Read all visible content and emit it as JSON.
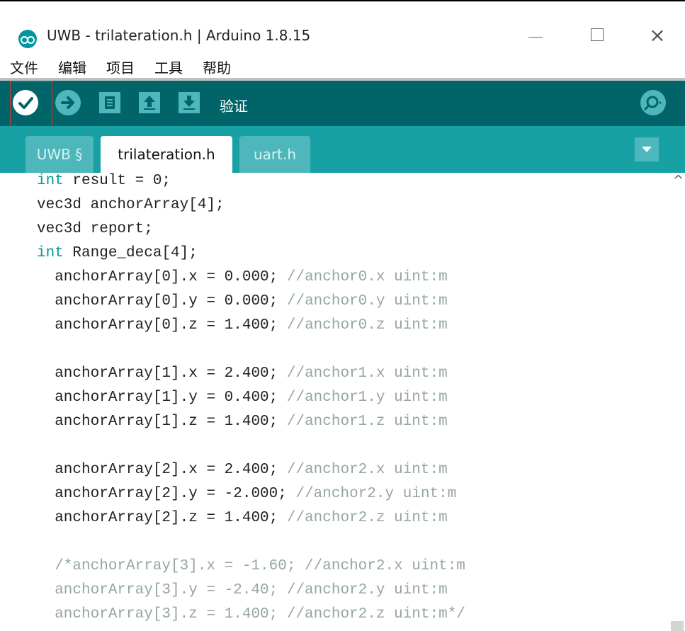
{
  "window": {
    "title": "UWB - trilateration.h | Arduino 1.8.15",
    "minimize_label": "—",
    "maximize_label": "☐",
    "close_label": "×"
  },
  "menubar": {
    "items": [
      "文件",
      "编辑",
      "项目",
      "工具",
      "帮助"
    ]
  },
  "toolbar": {
    "tooltip": "验证"
  },
  "tabs": [
    "UWB §",
    "trilateration.h",
    "uart.h"
  ],
  "editor": {
    "lines": [
      "int result = 0;",
      "vec3d anchorArray[4];",
      "vec3d report;",
      "int Range_deca[4];",
      "  anchorArray[0].x = 0.000; //anchor0.x uint:m",
      "  anchorArray[0].y = 0.000; //anchor0.y uint:m",
      "  anchorArray[0].z = 1.400; //anchor0.z uint:m",
      "",
      "  anchorArray[1].x = 2.400; //anchor1.x uint:m",
      "  anchorArray[1].y = 0.400; //anchor1.y uint:m",
      "  anchorArray[1].z = 1.400; //anchor1.z uint:m",
      "",
      "  anchorArray[2].x = 2.400; //anchor2.x uint:m",
      "  anchorArray[2].y = -2.000; //anchor2.y uint:m",
      "  anchorArray[2].z = 1.400; //anchor2.z uint:m",
      "",
      "  /*anchorArray[3].x = -1.60; //anchor2.x uint:m",
      "  anchorArray[3].y = -2.40; //anchor2.y uint:m",
      "  anchorArray[3].z = 1.400; //anchor2.z uint:m*/"
    ]
  },
  "colors": {
    "toolbar": "#006468",
    "tabbar": "#17a1a5",
    "keyword": "#00979c",
    "comment": "#95a5a6"
  },
  "icons": {
    "verify": "check-icon",
    "upload": "arrow-right-icon",
    "new": "new-file-icon",
    "open": "arrow-up-icon",
    "save": "arrow-down-icon",
    "serial": "magnifier-icon",
    "tab_menu": "triangle-down-icon"
  }
}
